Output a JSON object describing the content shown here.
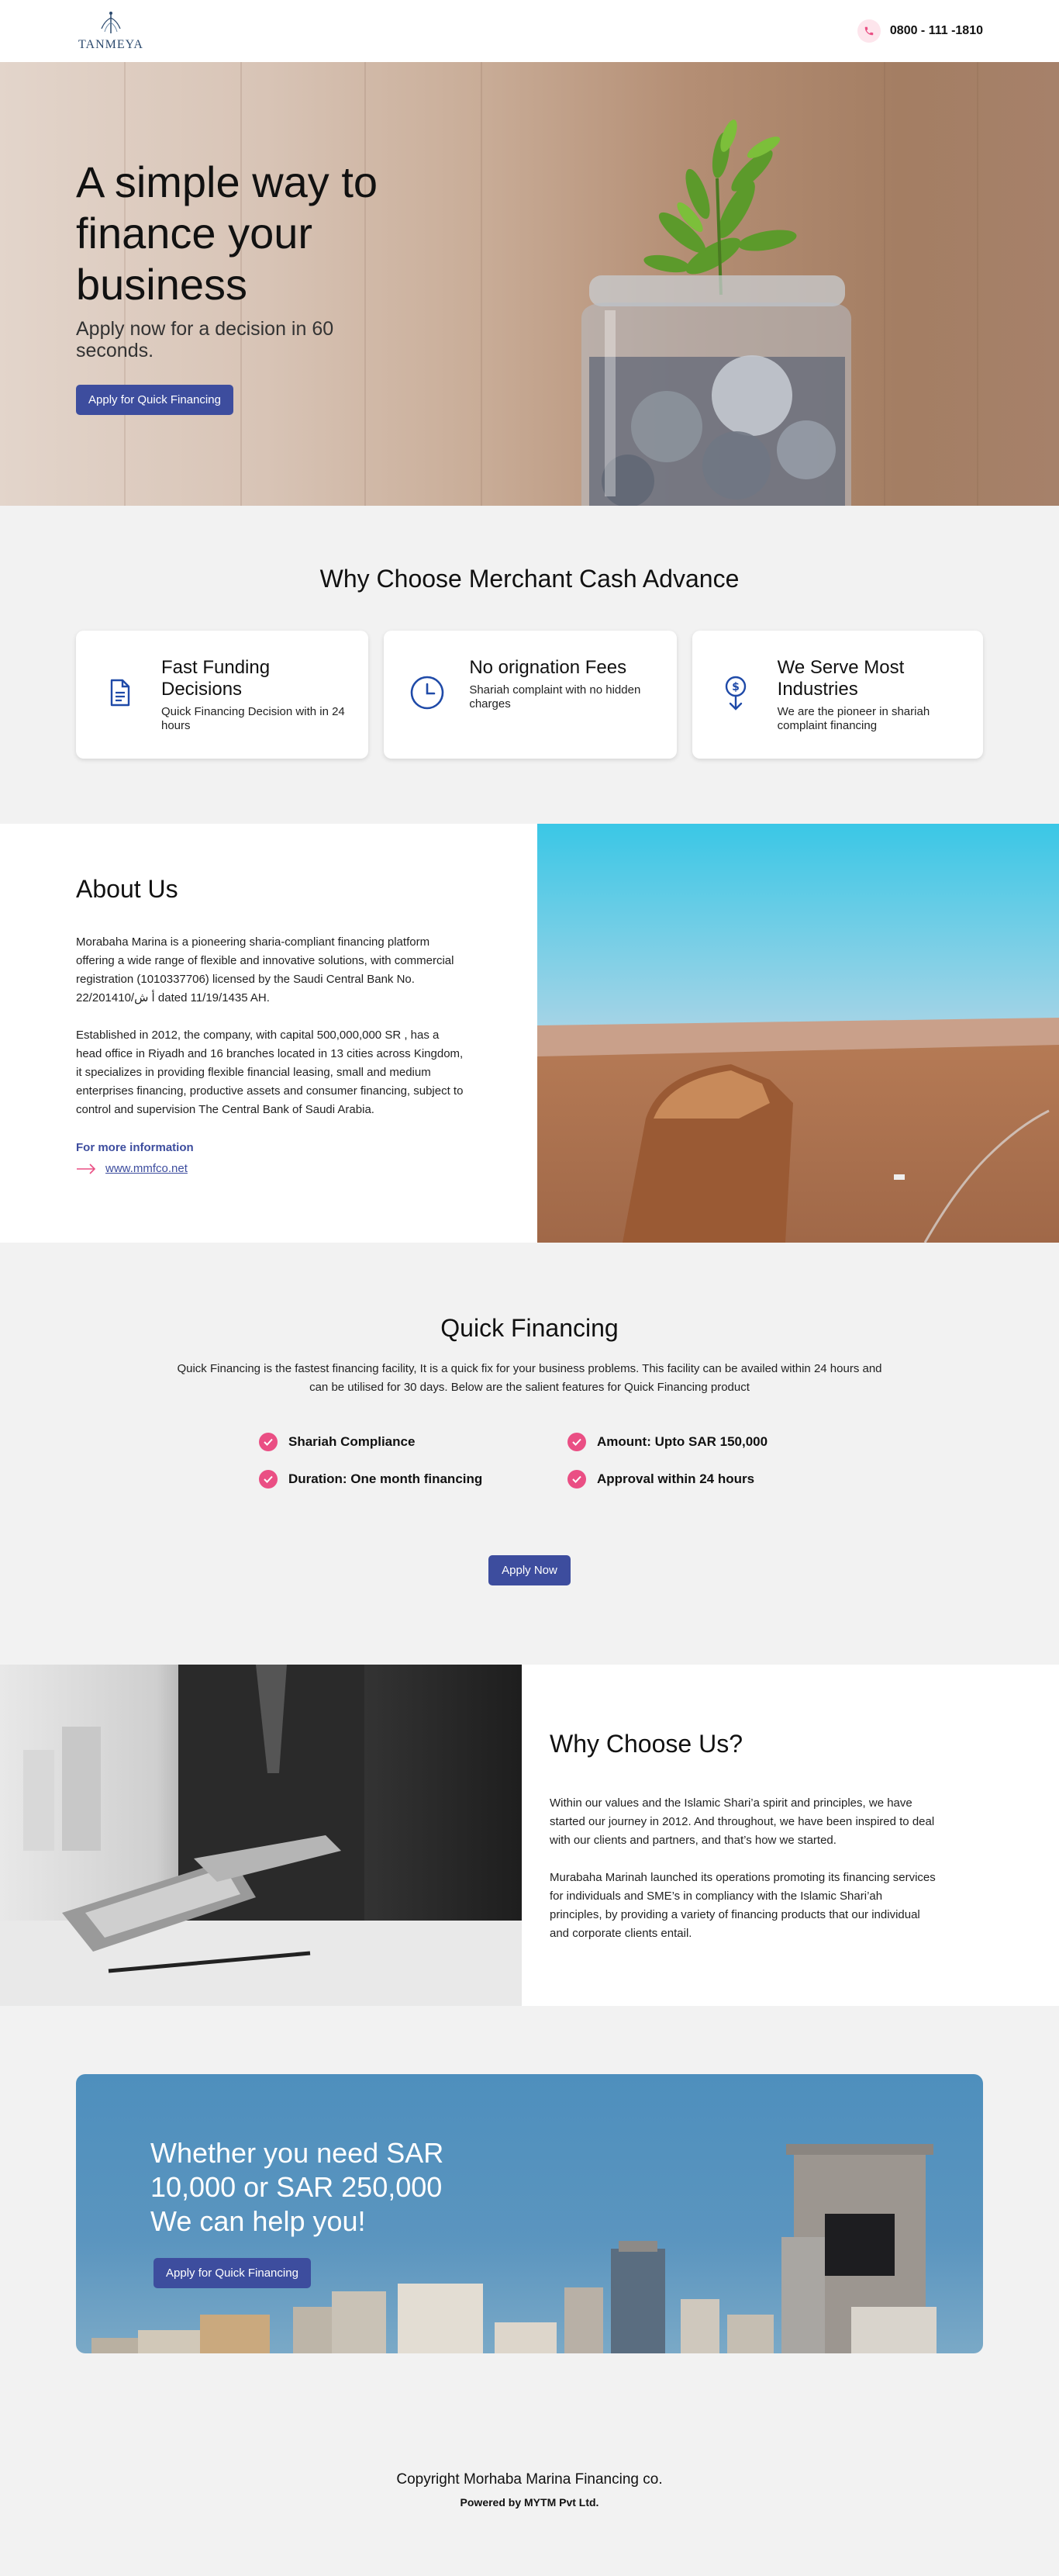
{
  "header": {
    "logo_text": "TANMEYA",
    "phone": "0800 - 111 -1810"
  },
  "hero": {
    "title": "A simple way to finance your business",
    "subtitle": "Apply now for a decision in 60 seconds.",
    "cta": "Apply for Quick Financing"
  },
  "why_mca": {
    "title": "Why Choose Merchant Cash Advance",
    "cards": [
      {
        "icon": "document-icon",
        "title": "Fast Funding Decisions",
        "desc": "Quick Financing Decision with in 24 hours"
      },
      {
        "icon": "clock-icon",
        "title": "No orignation Fees",
        "desc": "Shariah complaint with no hidden charges"
      },
      {
        "icon": "dollar-down-icon",
        "title": "We Serve Most Industries",
        "desc": "We are the pioneer in shariah complaint financing"
      }
    ]
  },
  "about": {
    "title": "About Us",
    "p1": "Morabaha Marina is a pioneering sharia-compliant financing platform offering a wide range of flexible and innovative solutions, with commercial registration (1010337706) licensed by the Saudi Central Bank No. 22/201410/أ ش dated 11/19/1435 AH.",
    "p2": "Established in 2012, the company, with capital 500,000,000 SR , has a head office in Riyadh and 16 branches located in 13 cities across Kingdom, it specializes in providing flexible financial leasing, small and medium enterprises financing, productive assets and consumer financing, subject to control and supervision The Central Bank of Saudi Arabia.",
    "more_label": "For more information",
    "link": "www.mmfco.net"
  },
  "quick_financing": {
    "title": "Quick Financing",
    "desc": "Quick Financing is the fastest financing facility, It is a quick fix for your business problems. This facility can be availed within 24 hours and can be utilised for 30 days. Below are the salient features for Quick Financing product",
    "features": [
      "Shariah Compliance",
      "Amount: Upto SAR 150,000",
      "Duration: One month financing",
      "Approval within 24 hours"
    ],
    "cta": "Apply Now"
  },
  "why_us": {
    "title": "Why Choose Us?",
    "p1": "Within our values and the Islamic Shari’a spirit and principles, we have started our journey in 2012. And throughout, we have been inspired to deal with our clients and partners, and that’s how we started.",
    "p2": "Murabaha Marinah launched its operations promoting its financing services for individuals and SME’s in compliancy with the Islamic Shari’ah principles, by providing a variety of financing products that our individual and corporate clients entail."
  },
  "banner": {
    "title": "Whether you need SAR 10,000 or SAR 250,000 We can help you!",
    "cta": "Apply for Quick Financing"
  },
  "footer": {
    "copyright": "Copyright Morhaba Marina Financing co.",
    "powered": "Powered by MYTM Pvt Ltd."
  },
  "colors": {
    "primary": "#3d4d9e",
    "accent": "#ea4f84",
    "icon_blue": "#1f4aa8"
  }
}
